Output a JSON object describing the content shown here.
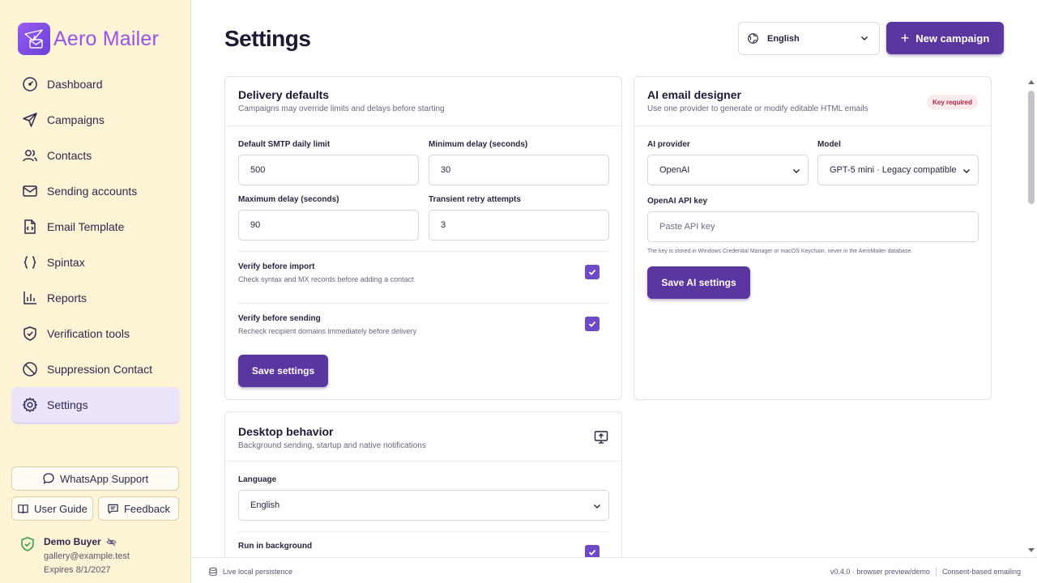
{
  "app": {
    "name": "Aero Mailer"
  },
  "sidebar": {
    "items": [
      {
        "label": "Dashboard",
        "icon": "dashboard-gauge-icon"
      },
      {
        "label": "Campaigns",
        "icon": "send-icon"
      },
      {
        "label": "Contacts",
        "icon": "users-icon"
      },
      {
        "label": "Sending accounts",
        "icon": "mail-icon"
      },
      {
        "label": "Email Template",
        "icon": "file-code-icon"
      },
      {
        "label": "Spintax",
        "icon": "braces-icon"
      },
      {
        "label": "Reports",
        "icon": "bar-chart-icon"
      },
      {
        "label": "Verification tools",
        "icon": "shield-check-icon"
      },
      {
        "label": "Suppression Contact",
        "icon": "ban-icon"
      },
      {
        "label": "Settings",
        "icon": "gear-icon",
        "active": true
      }
    ],
    "whatsapp": "WhatsApp Support",
    "user_guide": "User Guide",
    "feedback": "Feedback"
  },
  "user": {
    "name": "Demo Buyer",
    "email": "gallery@example.test",
    "expires": "Expires 8/1/2027"
  },
  "header": {
    "title": "Settings",
    "language": "English",
    "new_campaign": "New campaign"
  },
  "delivery": {
    "title": "Delivery defaults",
    "subtitle": "Campaigns may override limits and delays before starting",
    "daily_limit_label": "Default SMTP daily limit",
    "daily_limit_value": "500",
    "min_delay_label": "Minimum delay (seconds)",
    "min_delay_value": "30",
    "max_delay_label": "Maximum delay (seconds)",
    "max_delay_value": "90",
    "retry_label": "Transient retry attempts",
    "retry_value": "3",
    "verify_import_title": "Verify before import",
    "verify_import_sub": "Check syntax and MX records before adding a contact",
    "verify_import_checked": true,
    "verify_send_title": "Verify before sending",
    "verify_send_sub": "Recheck recipient domains immediately before delivery",
    "verify_send_checked": true,
    "save": "Save settings"
  },
  "ai": {
    "title": "AI email designer",
    "subtitle": "Use one provider to generate or modify editable HTML emails",
    "badge": "Key required",
    "provider_label": "AI provider",
    "provider_value": "OpenAI",
    "model_label": "Model",
    "model_value": "GPT-5 mini · Legacy compatible",
    "key_label": "OpenAI API key",
    "key_placeholder": "Paste API key",
    "note": "The key is stored in Windows Credential Manager or macOS Keychain, never in the AeroMailer database.",
    "save": "Save AI settings"
  },
  "desktop": {
    "title": "Desktop behavior",
    "subtitle": "Background sending, startup and native notifications",
    "language_label": "Language",
    "language_value": "English",
    "run_bg_title": "Run in background",
    "run_bg_checked": true
  },
  "footer": {
    "persistence": "Live local persistence",
    "version": "v0.4.0 · browser preview/demo",
    "consent": "Consent-based emailing"
  },
  "colors": {
    "accent": "#5a36a0",
    "sidebar_bg": "#fcf4d4",
    "brand_text": "#9a52e6",
    "badge_text": "#b0253f"
  }
}
